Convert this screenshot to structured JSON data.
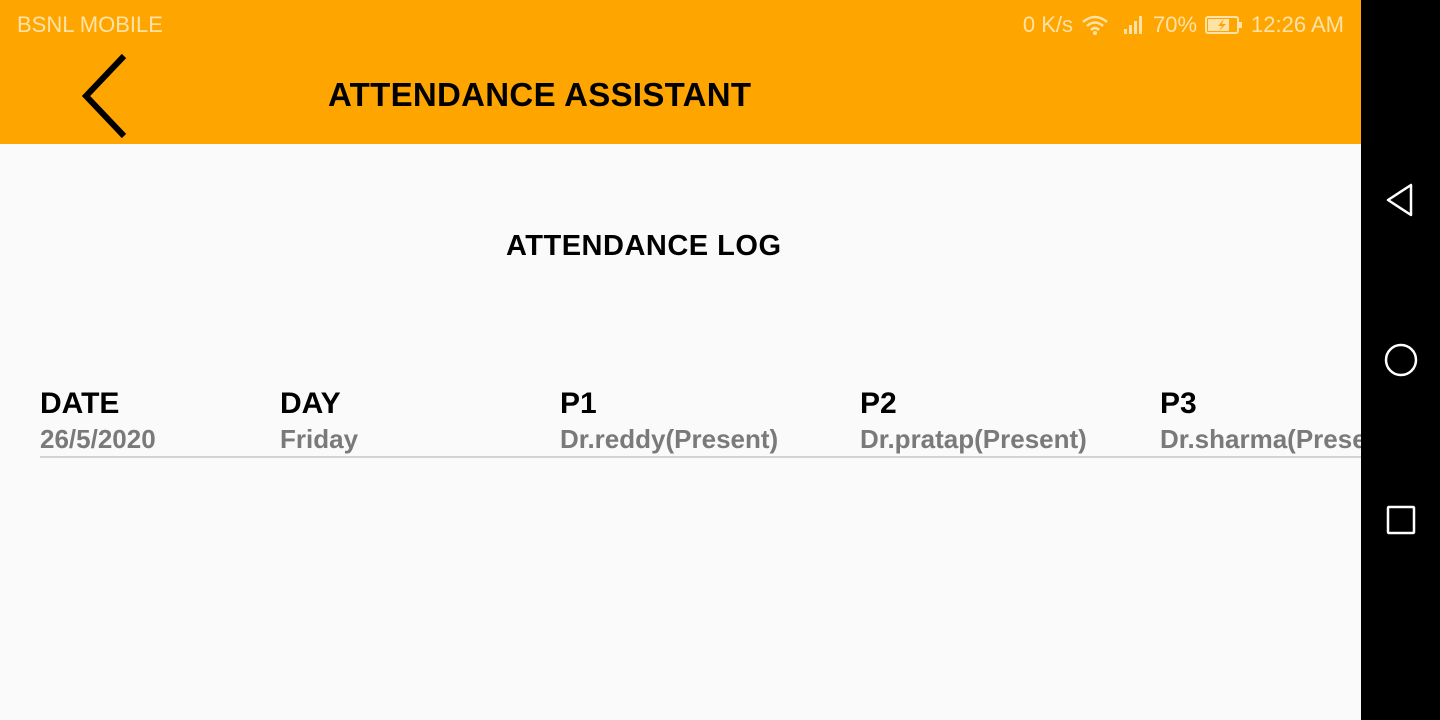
{
  "status_bar": {
    "carrier": "BSNL MOBILE",
    "speed": "0 K/s",
    "battery": "70%",
    "time": "12:26 AM"
  },
  "app_bar": {
    "title": "ATTENDANCE ASSISTANT",
    "back_icon": "chevron-left-icon"
  },
  "page": {
    "heading": "ATTENDANCE LOG"
  },
  "log_table": {
    "columns": [
      {
        "header": "DATE",
        "value": "26/5/2020"
      },
      {
        "header": "DAY",
        "value": "Friday"
      },
      {
        "header": "P1",
        "value": "Dr.reddy(Present)"
      },
      {
        "header": "P2",
        "value": "Dr.pratap(Present)"
      },
      {
        "header": "P3",
        "value": "Dr.sharma(Present)"
      }
    ]
  },
  "nav_bar": {
    "back_icon": "triangle-back-icon",
    "home_icon": "circle-home-icon",
    "recents_icon": "square-recents-icon"
  },
  "colors": {
    "app_bar": "#ffa500",
    "background": "#fafafa",
    "value_text": "#7a7a7a",
    "nav_bar": "#000000"
  }
}
